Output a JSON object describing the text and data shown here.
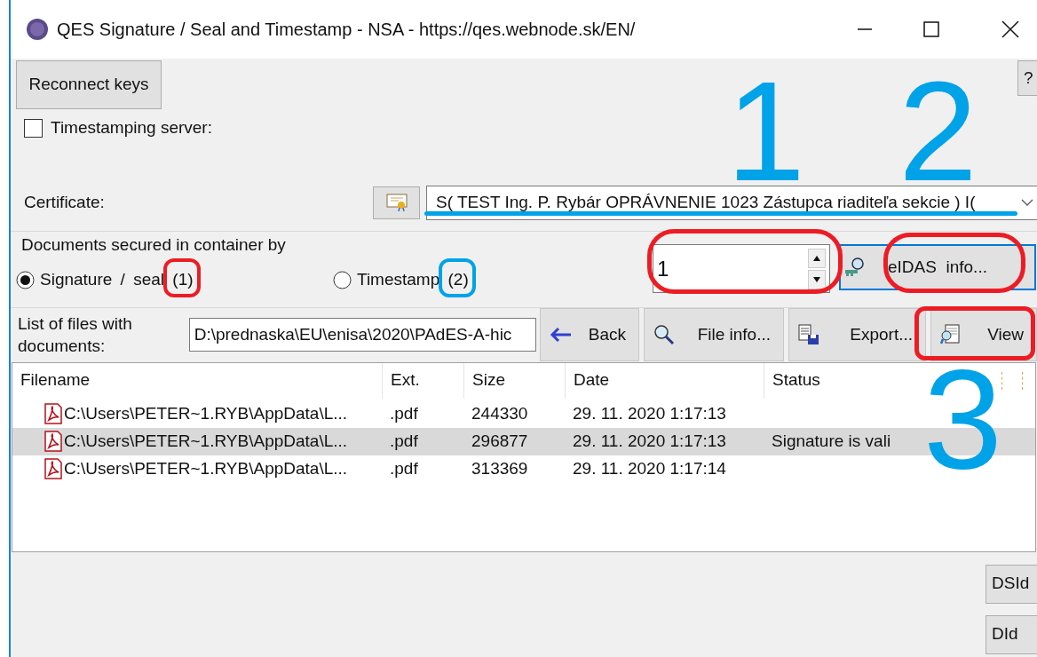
{
  "window": {
    "title": "QES Signature / Seal and Timestamp - NSA - https://qes.webnode.sk/EN/"
  },
  "reconnect_button": "Reconnect keys",
  "help_button": "?",
  "timestamping": {
    "label": "Timestamping server:",
    "checked": false
  },
  "certificate": {
    "label": "Certificate:",
    "value": "S( TEST Ing. P. Rybár OPRÁVNENIE 1023 Zástupca riaditeľa sekcie ) I("
  },
  "secured_by": {
    "label": "Documents secured in container by",
    "options": [
      {
        "label": "Signature / seal (1)",
        "selected": true
      },
      {
        "label": "Timestamp (2)",
        "selected": false
      }
    ]
  },
  "spinner": {
    "value": "1"
  },
  "eidas_button": "eIDAS  info...",
  "files": {
    "label": "List of files with documents:",
    "path": "D:\\prednaska\\EU\\enisa\\2020\\PAdES-A-hic"
  },
  "toolbar": [
    "Back",
    "File info...",
    "Export...",
    "View"
  ],
  "table": {
    "columns": [
      "Filename",
      "Ext.",
      "Size",
      "Date",
      "Status"
    ],
    "rows": [
      {
        "filename": "C:\\Users\\PETER~1.RYB\\AppData\\L...",
        "ext": ".pdf",
        "size": "244330",
        "date": "29. 11. 2020 1:17:13",
        "selected": false
      },
      {
        "filename": "C:\\Users\\PETER~1.RYB\\AppData\\L...",
        "ext": ".pdf",
        "size": "296877",
        "date": "29. 11. 2020 1:17:13",
        "status": "Signature is vali",
        "selected": true
      },
      {
        "filename": "C:\\Users\\PETER~1.RYB\\AppData\\L...",
        "ext": ".pdf",
        "size": "313369",
        "date": "29. 11. 2020 1:17:14",
        "selected": false
      }
    ]
  },
  "bottom_buttons": [
    "DSId",
    "DId"
  ],
  "annotations": {
    "numbers": [
      {
        "text": "1",
        "color": "#00a2e8"
      },
      {
        "text": "2",
        "color": "#00a2e8"
      },
      {
        "text": "3",
        "color": "#00a2e8"
      }
    ],
    "outlines": [
      {
        "kind": "underline",
        "color": "#00a2e8"
      },
      {
        "kind": "box",
        "color": "#00a2e8"
      },
      {
        "kind": "box",
        "color": "#ed1c24"
      },
      {
        "kind": "oval",
        "color": "#ed1c24"
      },
      {
        "kind": "oval",
        "color": "#ed1c24"
      },
      {
        "kind": "box",
        "color": "#ed1c24"
      }
    ]
  }
}
